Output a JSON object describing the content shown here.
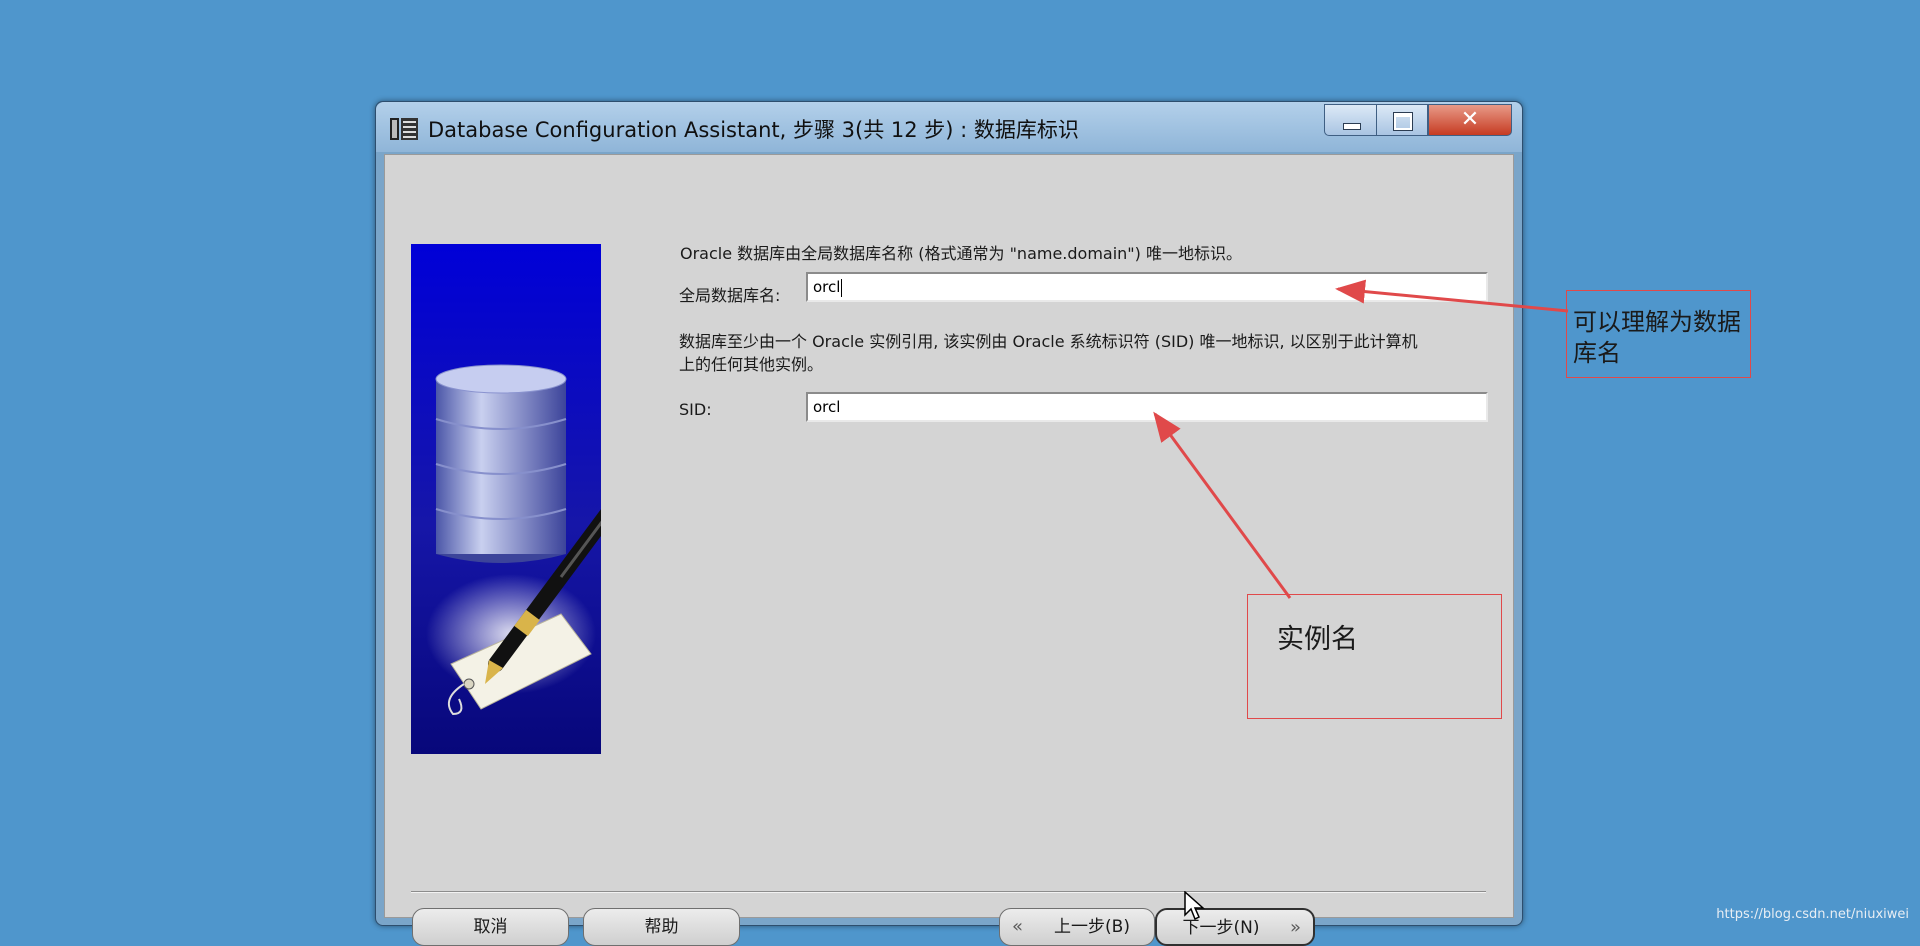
{
  "window": {
    "title": "Database Configuration Assistant, 步骤 3(共 12 步) : 数据库标识",
    "controls": {
      "minimize": "minimize",
      "maximize": "maximize",
      "close": "✕"
    }
  },
  "form": {
    "intro": "Oracle 数据库由全局数据库名称 (格式通常为 \"name.domain\") 唯一地标识。",
    "global_db_label": "全局数据库名:",
    "global_db_value": "orcl",
    "sid_desc_line1": "数据库至少由一个 Oracle 实例引用, 该实例由 Oracle 系统标识符 (SID) 唯一地标识, 以区别于此计算机",
    "sid_desc_line2": "上的任何其他实例。",
    "sid_label": "SID:",
    "sid_value": "orcl"
  },
  "buttons": {
    "cancel": "取消",
    "help": "帮助",
    "back": "上一步(B)",
    "next": "下一步(N)",
    "back_chevron": "«",
    "next_chevron": "»"
  },
  "annotations": {
    "global_db_note": "可以理解为数据库名",
    "sid_note": "实例名"
  },
  "watermark": "https://blog.csdn.net/niuxiwei",
  "colors": {
    "desktop": "#4f96cc",
    "annotation": "#e0494a",
    "banner": "#0a0ab8"
  }
}
